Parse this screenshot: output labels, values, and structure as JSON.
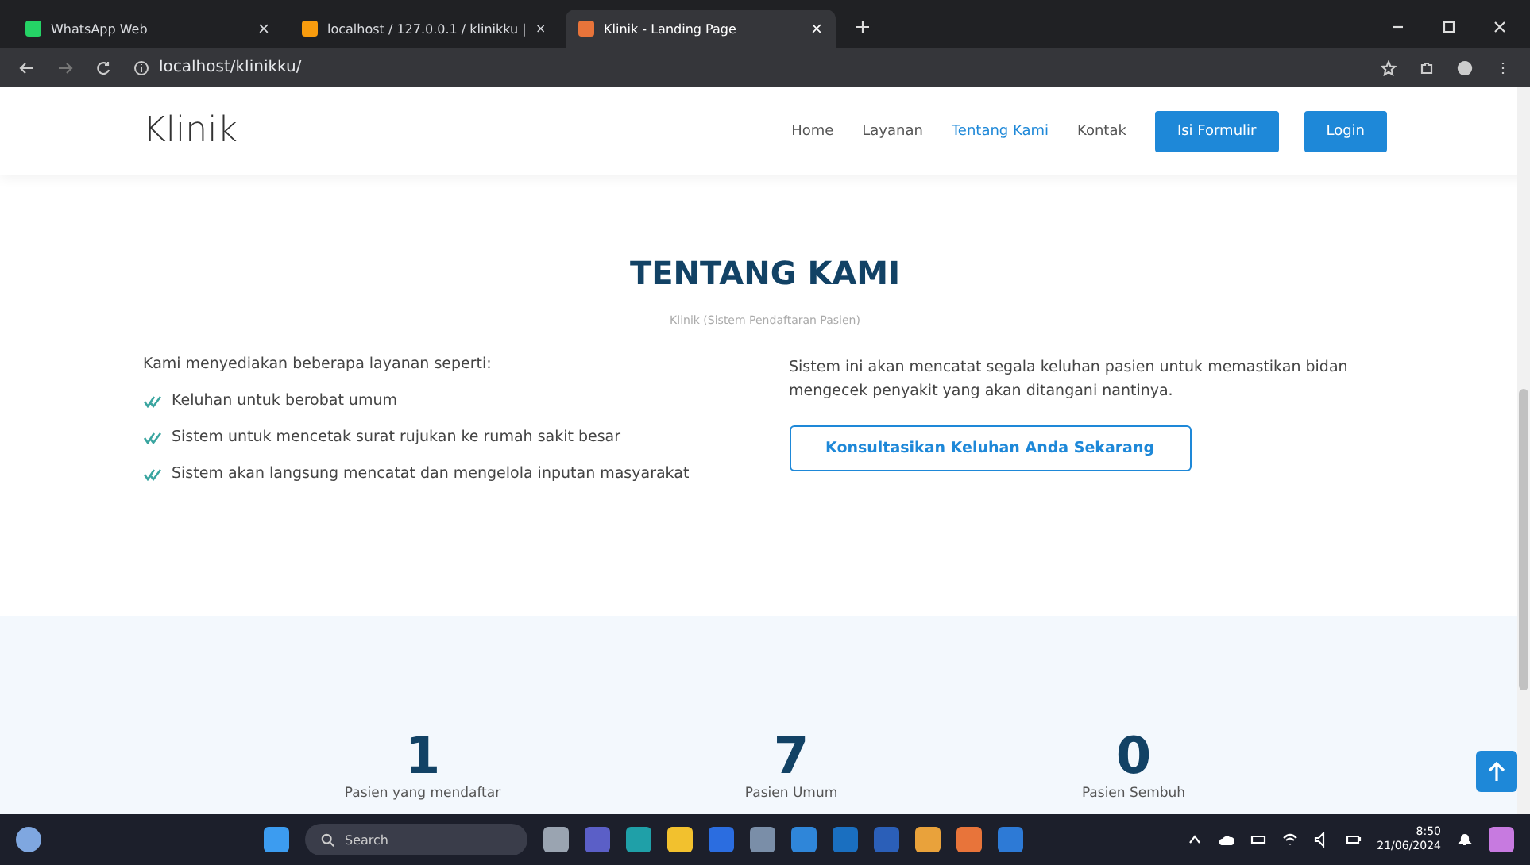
{
  "browser": {
    "tabs": [
      {
        "title": "WhatsApp Web",
        "selected": false
      },
      {
        "title": "localhost / 127.0.0.1 / klinikku |",
        "selected": false
      },
      {
        "title": "Klinik - Landing Page",
        "selected": true
      }
    ],
    "address": "localhost/klinikku/"
  },
  "navbar": {
    "brand": "Klinik",
    "links": [
      {
        "label": "Home",
        "selected": false
      },
      {
        "label": "Layanan",
        "selected": false
      },
      {
        "label": "Tentang Kami",
        "selected": true
      },
      {
        "label": "Kontak",
        "selected": false
      }
    ],
    "buttons": [
      "Isi Formulir",
      "Login"
    ]
  },
  "about": {
    "title": "TENTANG KAMI",
    "subtitle": "Klinik (Sistem Pendaftaran Pasien)",
    "intro": "Kami menyediakan beberapa layanan seperti:",
    "items": [
      "Keluhan untuk berobat umum",
      "Sistem untuk mencetak surat rujukan ke rumah sakit besar",
      "Sistem akan langsung mencatat dan mengelola inputan masyarakat"
    ],
    "description": "Sistem ini akan mencatat segala keluhan pasien untuk memastikan bidan mengecek penyakit yang akan ditangani nantinya.",
    "cta": "Konsultasikan Keluhan Anda Sekarang"
  },
  "stats": [
    {
      "value": "1",
      "label": "Pasien yang mendaftar"
    },
    {
      "value": "7",
      "label": "Pasien Umum"
    },
    {
      "value": "0",
      "label": "Pasien Sembuh"
    }
  ],
  "taskbar": {
    "search": "Search",
    "time": "8:50",
    "date": "21/06/2024"
  }
}
